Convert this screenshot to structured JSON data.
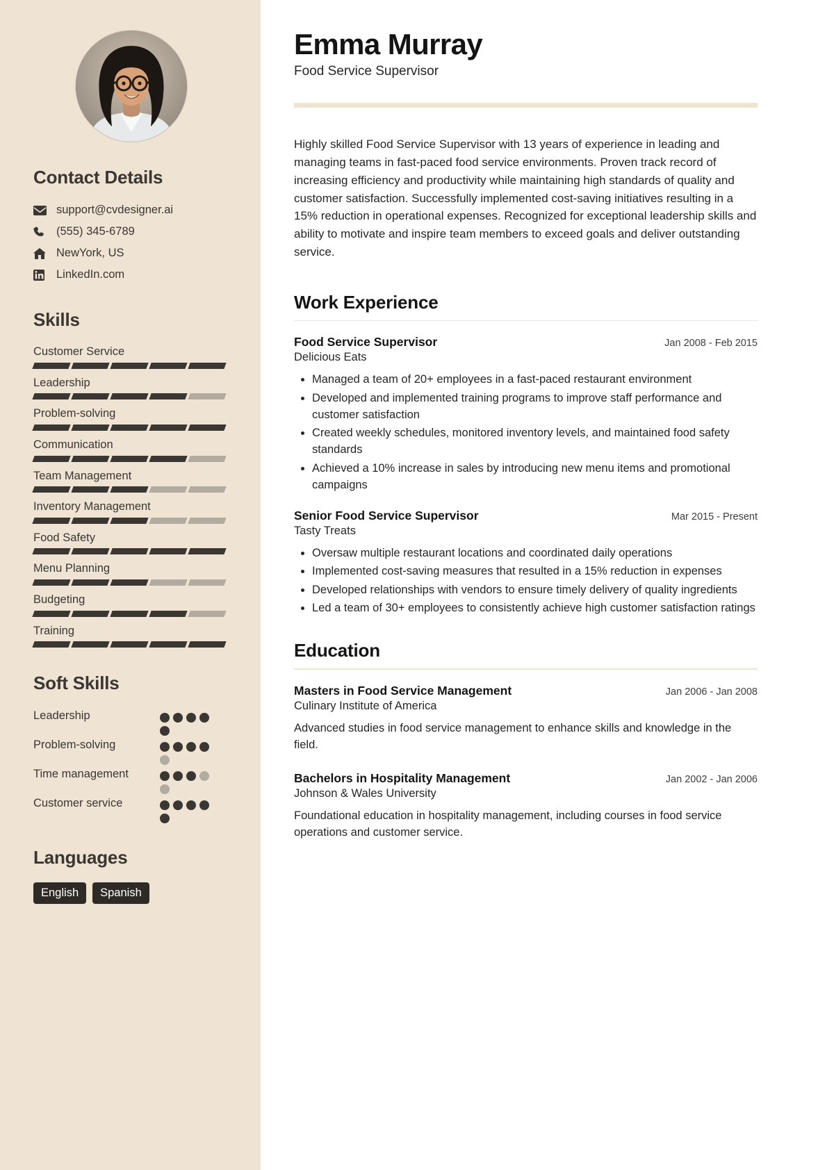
{
  "sidebar": {
    "avatar_alt": "profile-photo",
    "contact": {
      "heading": "Contact Details",
      "items": [
        {
          "icon": "envelope-icon",
          "text": "support@cvdesigner.ai"
        },
        {
          "icon": "phone-icon",
          "text": "(555) 345-6789"
        },
        {
          "icon": "home-icon",
          "text": "NewYork, US"
        },
        {
          "icon": "linkedin-icon",
          "text": "LinkedIn.com"
        }
      ]
    },
    "skills": {
      "heading": "Skills",
      "segments_total": 5,
      "items": [
        {
          "name": "Customer Service",
          "level": 5
        },
        {
          "name": "Leadership",
          "level": 4
        },
        {
          "name": "Problem-solving",
          "level": 5
        },
        {
          "name": "Communication",
          "level": 4
        },
        {
          "name": "Team Management",
          "level": 3
        },
        {
          "name": "Inventory Management",
          "level": 3
        },
        {
          "name": "Food Safety",
          "level": 5
        },
        {
          "name": "Menu Planning",
          "level": 3
        },
        {
          "name": "Budgeting",
          "level": 4
        },
        {
          "name": "Training",
          "level": 5
        }
      ]
    },
    "soft_skills": {
      "heading": "Soft Skills",
      "dots_total": 5,
      "items": [
        {
          "name": "Leadership",
          "level": 5
        },
        {
          "name": "Problem-solving",
          "level": 4
        },
        {
          "name": "Time management",
          "level": 3
        },
        {
          "name": "Customer service",
          "level": 5
        }
      ]
    },
    "languages": {
      "heading": "Languages",
      "items": [
        "English",
        "Spanish"
      ]
    }
  },
  "main": {
    "name": "Emma Murray",
    "job_title": "Food Service Supervisor",
    "summary": "Highly skilled Food Service Supervisor with 13 years of experience in leading and managing teams in fast-paced food service environments. Proven track record of increasing efficiency and productivity while maintaining high standards of quality and customer satisfaction. Successfully implemented cost-saving initiatives resulting in a 15% reduction in operational expenses. Recognized for exceptional leadership skills and ability to motivate and inspire team members to exceed goals and deliver outstanding service.",
    "work": {
      "heading": "Work Experience",
      "entries": [
        {
          "title": "Food Service Supervisor",
          "date": "Jan 2008 - Feb 2015",
          "org": "Delicious Eats",
          "bullets": [
            "Managed a team of 20+ employees in a fast-paced restaurant environment",
            "Developed and implemented training programs to improve staff performance and customer satisfaction",
            "Created weekly schedules, monitored inventory levels, and maintained food safety standards",
            "Achieved a 10% increase in sales by introducing new menu items and promotional campaigns"
          ]
        },
        {
          "title": "Senior Food Service Supervisor",
          "date": "Mar 2015 - Present",
          "org": "Tasty Treats",
          "bullets": [
            "Oversaw multiple restaurant locations and coordinated daily operations",
            "Implemented cost-saving measures that resulted in a 15% reduction in expenses",
            "Developed relationships with vendors to ensure timely delivery of quality ingredients",
            "Led a team of 30+ employees to consistently achieve high customer satisfaction ratings"
          ]
        }
      ]
    },
    "education": {
      "heading": "Education",
      "entries": [
        {
          "title": "Masters in Food Service Management",
          "date": "Jan 2006 - Jan 2008",
          "org": "Culinary Institute of America",
          "description": "Advanced studies in food service management to enhance skills and knowledge in the field."
        },
        {
          "title": "Bachelors in Hospitality Management",
          "date": "Jan 2002 - Jan 2006",
          "org": "Johnson & Wales University",
          "description": "Foundational education in hospitality management, including courses in food service operations and customer service."
        }
      ]
    }
  },
  "colors": {
    "sidebar_bg": "#efe3d4",
    "ink": "#3a3631",
    "muted_bar": "#b3aba0",
    "accent_rule": "#efe3d4",
    "chip_bg": "#2e2b27"
  }
}
